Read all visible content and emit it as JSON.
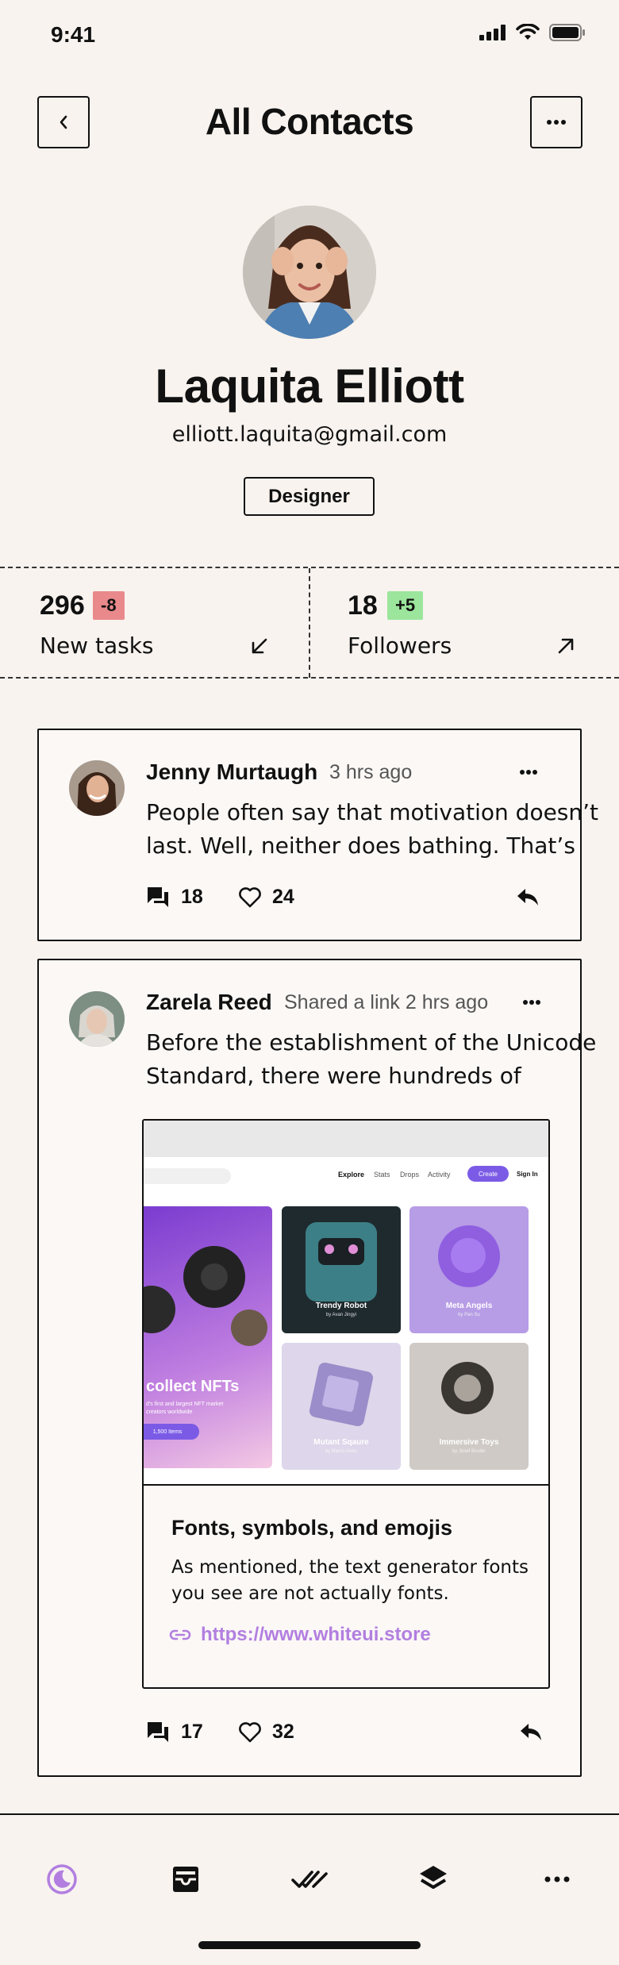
{
  "status": {
    "time": "9:41"
  },
  "header": {
    "title": "All Contacts",
    "back_icon": "chevron-left-icon",
    "more_icon": "more-horizontal-icon"
  },
  "profile": {
    "name": "Laquita Elliott",
    "email": "elliott.laquita@gmail.com",
    "role": "Designer"
  },
  "stats": [
    {
      "value": "296",
      "delta": "-8",
      "label": "New tasks",
      "delta_color": "#e9898b",
      "icon": "arrow-down-left-icon"
    },
    {
      "value": "18",
      "delta": "+5",
      "label": "Followers",
      "delta_color": "#9be59c",
      "icon": "arrow-up-right-icon"
    }
  ],
  "posts": [
    {
      "author": "Jenny Murtaugh",
      "meta": "3 hrs ago",
      "text_line1": "People often say that motivation doesn’t",
      "text_line2": "last. Well, neither does bathing. That’s",
      "comments": "18",
      "likes": "24"
    },
    {
      "author": "Zarela Reed",
      "meta": "Shared a link 2 hrs ago",
      "text_line1": "Before the establishment of the Unicode",
      "text_line2": "Standard, there were hundreds of",
      "comments": "17",
      "likes": "32",
      "preview": {
        "nav": {
          "explore": "Explore",
          "stats": "Stats",
          "drops": "Drops",
          "activity": "Activity",
          "create": "Create",
          "signin": "Sign In"
        },
        "hero_title": "collect NFTs",
        "hero_sub1": "d's first and largest NFT market",
        "hero_sub2": "creators worldwide",
        "hero_button": "1,500 Items",
        "tiles": [
          {
            "title": "Trendy Robot",
            "sub": "by Avan Jingyi"
          },
          {
            "title": "Meta Angels",
            "sub": "by Pan Su"
          },
          {
            "title": "Mutant Sqaure",
            "sub": "by Marco Alves"
          },
          {
            "title": "Immersive Toys",
            "sub": "by Josef Bruder"
          }
        ],
        "title": "Fonts, symbols, and emojis",
        "desc_line1": "As mentioned, the text generator fonts",
        "desc_line2": "you see are not actually fonts.",
        "link": "https://www.whiteui.store"
      }
    }
  ],
  "nav": {
    "active_color": "#b27fe0",
    "items": [
      "moon-icon",
      "inbox-icon",
      "double-check-icon",
      "layers-icon",
      "more-horizontal-icon"
    ]
  }
}
